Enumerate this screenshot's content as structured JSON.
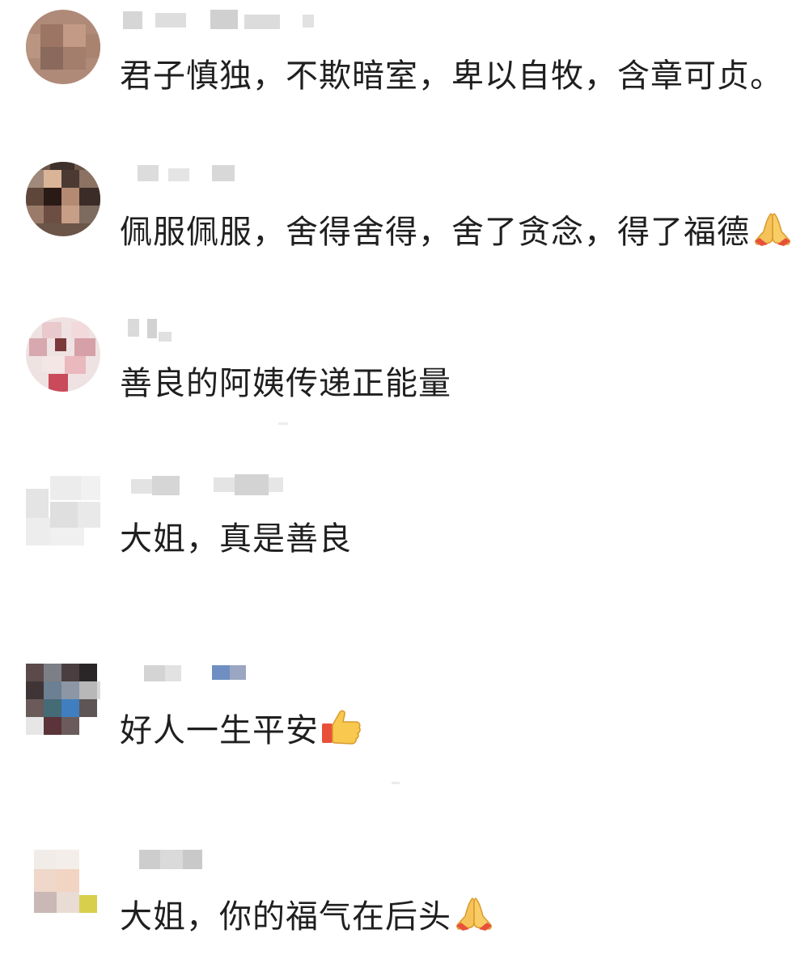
{
  "comments": [
    {
      "text": "君子慎独，不欺暗室，卑以自牧，含章可贞。",
      "emoji": ""
    },
    {
      "text": "佩服佩服，舍得舍得，舍了贪念，得了福德",
      "emoji": "folded-hands-icon"
    },
    {
      "text": "善良的阿姨传递正能量",
      "emoji": ""
    },
    {
      "text": "大姐，真是善良",
      "emoji": ""
    },
    {
      "text": "好人一生平安",
      "emoji": "thumbs-up-icon"
    },
    {
      "text": "大姐，你的福气在后头",
      "emoji": "folded-hands-icon"
    }
  ],
  "colors": {
    "text": "#1f1f1f",
    "background": "#ffffff",
    "username_blur": "#d9d9d9"
  }
}
